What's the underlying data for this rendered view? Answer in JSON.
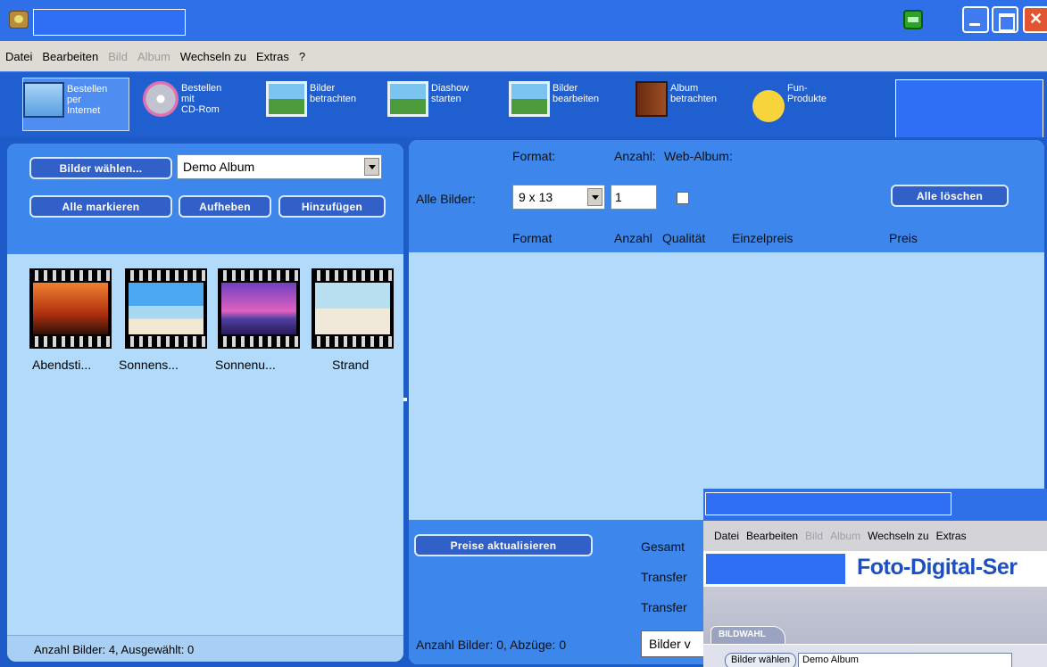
{
  "window": {
    "title": ""
  },
  "menu": {
    "items": [
      {
        "label": "Datei",
        "enabled": true
      },
      {
        "label": "Bearbeiten",
        "enabled": true
      },
      {
        "label": "Bild",
        "enabled": false
      },
      {
        "label": "Album",
        "enabled": false
      },
      {
        "label": "Wechseln zu",
        "enabled": true
      },
      {
        "label": "Extras",
        "enabled": true
      },
      {
        "label": "?",
        "enabled": true
      }
    ]
  },
  "toolbar": {
    "items": [
      {
        "label": "Bestellen\nper\nInternet",
        "icon": "monitor-icon",
        "active": true
      },
      {
        "label": "Bestellen\nmit\nCD-Rom",
        "icon": "cd-icon",
        "active": false
      },
      {
        "label": "Bilder\nbetrachten",
        "icon": "magnifier-photo-icon",
        "active": false
      },
      {
        "label": "Diashow\nstarten",
        "icon": "slideshow-icon",
        "active": false
      },
      {
        "label": "Bilder\nbearbeiten",
        "icon": "edit-photo-icon",
        "active": false
      },
      {
        "label": "Album\nbetrachten",
        "icon": "album-book-icon",
        "active": false
      },
      {
        "label": "Fun-\nProdukte",
        "icon": "smiley-icon",
        "active": false
      }
    ]
  },
  "left_panel": {
    "choose_button": "Bilder wählen...",
    "album_select": "Demo Album",
    "mark_all_button": "Alle markieren",
    "unmark_button": "Aufheben",
    "add_button": "Hinzufügen",
    "thumbnails": [
      {
        "label": "Abendsti...",
        "icon": "sunset-palms-photo"
      },
      {
        "label": "Sonnens...",
        "icon": "beach-umbrella-photo"
      },
      {
        "label": "Sonnenu...",
        "icon": "sunset-sea-photo"
      },
      {
        "label": "Strand",
        "icon": "beach-woman-photo"
      }
    ],
    "status": "Anzahl Bilder: 4, Ausgewählt: 0"
  },
  "right_panel": {
    "header_format": "Format:",
    "header_anzahl": "Anzahl:",
    "header_webalbum": "Web-Album:",
    "all_images_label": "Alle Bilder:",
    "format_select": "9 x 13",
    "quantity": "1",
    "delete_all_button": "Alle löschen",
    "columns": [
      "Format",
      "Anzahl",
      "Qualität",
      "Einzelpreis",
      "Preis"
    ],
    "update_prices_button": "Preise aktualisieren",
    "total_label": "Gesamt",
    "transfer_label_1": "Transfer",
    "transfer_label_2": "Transfer",
    "status": "Anzahl Bilder: 0, Abzüge: 0",
    "bottom_button": "Bilder v"
  },
  "overlay": {
    "menu_items": [
      {
        "label": "Datei",
        "enabled": true
      },
      {
        "label": "Bearbeiten",
        "enabled": true
      },
      {
        "label": "Bild",
        "enabled": false
      },
      {
        "label": "Album",
        "enabled": false
      },
      {
        "label": "Wechseln zu",
        "enabled": true
      },
      {
        "label": "Extras",
        "enabled": true
      }
    ],
    "brand": "Foto-Digital-Ser",
    "tab": "BILDWAHL",
    "choose_button": "Bilder wählen",
    "album_select": "Demo Album"
  },
  "colors": {
    "titlebar": "#2f6fe8",
    "toolbar": "#1f5fd0",
    "panel_header": "#3c86ec",
    "panel_body": "#b2dafa",
    "button": "#3060c8"
  }
}
